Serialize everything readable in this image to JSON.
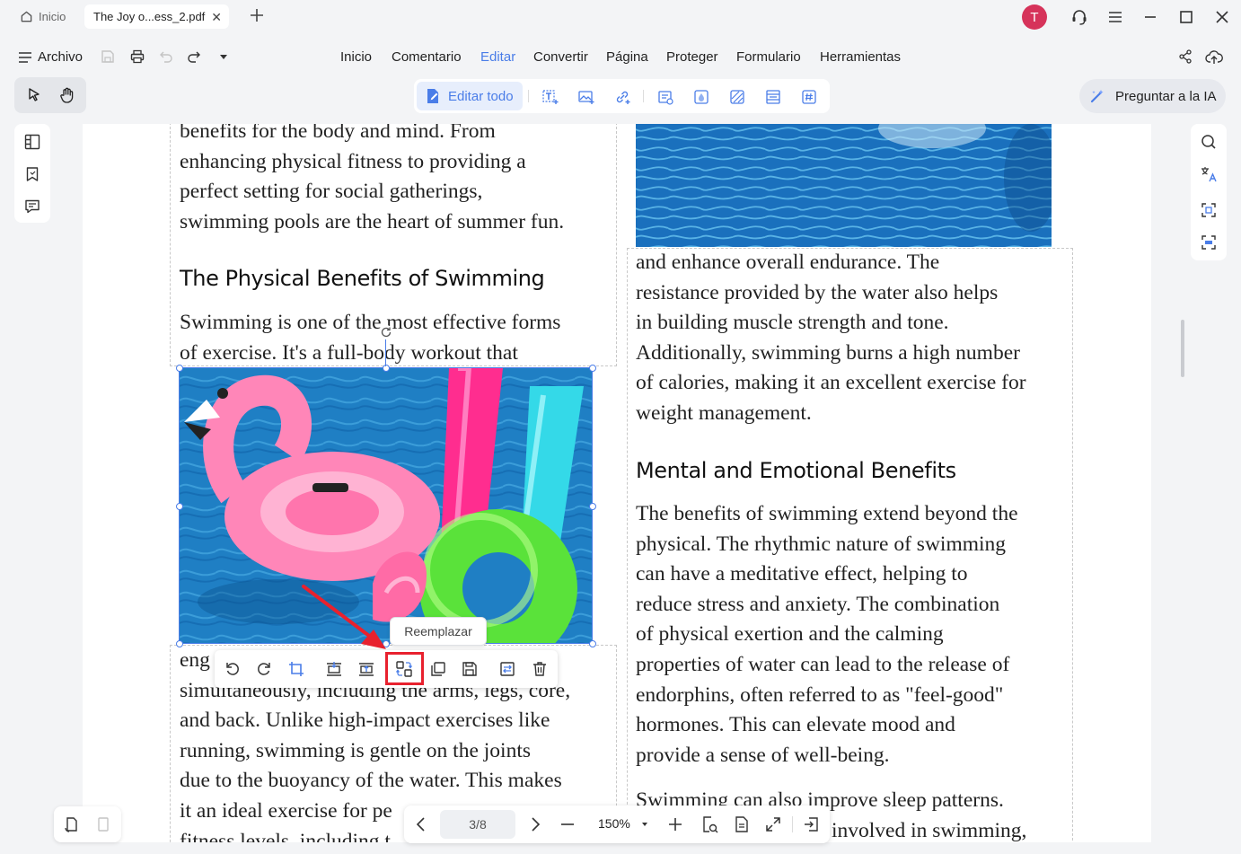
{
  "titlebar": {
    "home_tab": "Inicio",
    "doc_tab": "The Joy o...ess_2.pdf",
    "avatar_letter": "T"
  },
  "menu": {
    "file": "Archivo",
    "items": [
      "Inicio",
      "Comentario",
      "Editar",
      "Convertir",
      "Página",
      "Proteger",
      "Formulario",
      "Herramientas"
    ],
    "active": "Editar"
  },
  "toolbar": {
    "edit_all": "Editar todo",
    "ask_ai": "Preguntar a la IA"
  },
  "document": {
    "left_top_lines": [
      "benefits for the body and mind. From",
      "enhancing physical fitness to providing a",
      "perfect setting for social gatherings,",
      "swimming pools are the heart of summer fun."
    ],
    "heading_physical": "The Physical Benefits of Swimming",
    "left_mid_lines": [
      "Swimming is one of the most effective forms",
      "of exercise. It's a full-body workout that"
    ],
    "left_bottom_first": "eng",
    "left_bottom_lines": [
      "simultaneously, including the arms, legs, core,",
      "and back. Unlike high-impact exercises like",
      "running, swimming is gentle on the joints",
      "due to the buoyancy of the water. This makes",
      "it an ideal exercise for pe",
      "fitness levels, including t"
    ],
    "right_top_lines": [
      "and enhance overall endurance. The",
      "resistance provided by the water also helps",
      "in building muscle strength and tone.",
      "Additionally, swimming burns a high number",
      "of calories, making it an excellent exercise for",
      "weight management."
    ],
    "heading_mental": "Mental and Emotional Benefits",
    "right_mid_lines": [
      "The benefits of swimming extend beyond the",
      "physical. The rhythmic nature of swimming",
      "can have a meditative effect, helping to",
      "reduce stress and anxiety. The combination",
      "of physical exertion and the calming",
      "properties of water can lead to the release of",
      "endorphins, often referred to as \"feel-good\"",
      "hormones. This can elevate mood and",
      "provide a sense of well-being."
    ],
    "right_bottom_lines": [
      "Swimming can also improve sleep patterns.",
      "involved in swimming,"
    ]
  },
  "image_toolbar": {
    "tooltip": "Reemplazar"
  },
  "navigation": {
    "page_indicator": "3/8",
    "zoom": "150%"
  },
  "colors": {
    "accent": "#4a7de8",
    "highlight": "#e8212e",
    "avatar": "#d6335a"
  }
}
